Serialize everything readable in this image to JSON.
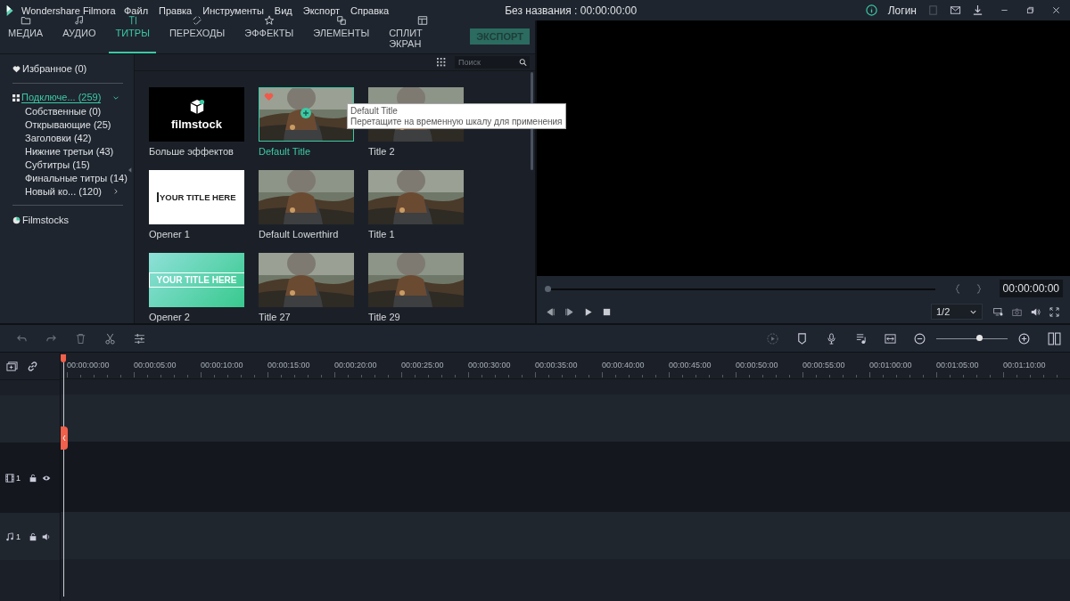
{
  "app": {
    "name": "Wondershare Filmora"
  },
  "menu": [
    "Файл",
    "Правка",
    "Инструменты",
    "Вид",
    "Экспорт",
    "Справка"
  ],
  "document_title": "Без названия : 00:00:00:00",
  "account": {
    "login": "Логин"
  },
  "tabs": [
    {
      "label": "МЕДИА",
      "selected": false
    },
    {
      "label": "АУДИО",
      "selected": false
    },
    {
      "label": "ТИТРЫ",
      "selected": true
    },
    {
      "label": "ПЕРЕХОДЫ",
      "selected": false
    },
    {
      "label": "ЭФФЕКТЫ",
      "selected": false
    },
    {
      "label": "ЭЛЕМЕНТЫ",
      "selected": false
    },
    {
      "label": "СПЛИТ ЭКРАН",
      "selected": false
    }
  ],
  "export_button": "ЭКСПОРТ",
  "search": {
    "placeholder": "Поиск"
  },
  "sidebar": {
    "favorites": "Избранное (0)",
    "group": {
      "label": "Подключе... (259)",
      "expanded": true,
      "children": [
        {
          "label": "Собственные (0)",
          "expandable": false
        },
        {
          "label": "Открывающие (25)",
          "expandable": false
        },
        {
          "label": "Заголовки (42)",
          "expandable": false
        },
        {
          "label": "Нижние третьи (43)",
          "expandable": false
        },
        {
          "label": "Субтитры (15)",
          "expandable": false
        },
        {
          "label": "Финальные титры (14)",
          "expandable": false
        },
        {
          "label": "Новый ко... (120)",
          "expandable": true
        }
      ]
    },
    "filmstocks": "Filmstocks"
  },
  "grid": [
    {
      "label": "Больше эффектов",
      "kind": "brand",
      "text": "filmstock",
      "selected": false
    },
    {
      "label": "Default Title",
      "selected": true
    },
    {
      "label": "Title 2",
      "selected": false
    },
    {
      "label": "Opener 1",
      "kind": "plain",
      "text": "YOUR TITLE HERE",
      "selected": false
    },
    {
      "label": "Default Lowerthird",
      "selected": false
    },
    {
      "label": "Title 1",
      "selected": false
    },
    {
      "label": "Opener 2",
      "kind": "gradient",
      "text": "YOUR TITLE HERE",
      "selected": false
    },
    {
      "label": "Title 27",
      "selected": false
    },
    {
      "label": "Title 29",
      "selected": false
    }
  ],
  "tooltip": {
    "title": "Default Title",
    "hint": "Перетащите на временную шкалу для применения"
  },
  "preview": {
    "level": 0,
    "timecode": "00:00:00:00",
    "quality": "1/2"
  },
  "timeline": {
    "zoom": {
      "level": 0.6
    },
    "ticks": [
      "00:00:00:00",
      "00:00:05:00",
      "00:00:10:00",
      "00:00:15:00",
      "00:00:20:00",
      "00:00:25:00",
      "00:00:30:00",
      "00:00:35:00",
      "00:00:40:00",
      "00:00:45:00",
      "00:00:50:00",
      "00:00:55:00",
      "00:01:00:00",
      "00:01:05:00",
      "00:01:10:00"
    ],
    "tracks": [
      {
        "kind": "video",
        "number": "1"
      },
      {
        "kind": "audio",
        "number": "1"
      }
    ]
  }
}
